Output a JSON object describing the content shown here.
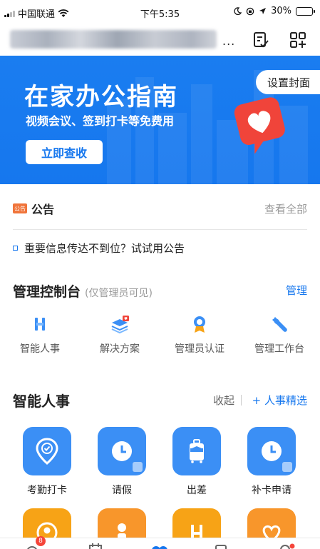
{
  "status_bar": {
    "carrier": "中国联通",
    "time": "下午5:35",
    "battery": "30%",
    "battery_level": 0.3
  },
  "title_bar": {
    "more": "..."
  },
  "banner": {
    "title": "在家办公指南",
    "subtitle": "视频会议、签到打卡等免费用",
    "action": "立即查收",
    "cover_button": "设置封面",
    "background_color": "#1677ee"
  },
  "notice": {
    "badge": "公告",
    "title": "公告",
    "view_all": "查看全部",
    "item": "重要信息传达不到位？试试用公告"
  },
  "admin_console": {
    "title": "管理控制台",
    "note": "(仅管理员可见)",
    "manage": "管理",
    "items": [
      {
        "label": "智能人事",
        "icon": "smart-hr-icon"
      },
      {
        "label": "解决方案",
        "icon": "layers-icon"
      },
      {
        "label": "管理员认证",
        "icon": "badge-icon"
      },
      {
        "label": "管理工作台",
        "icon": "wrench-icon"
      }
    ]
  },
  "smart_hr": {
    "title": "智能人事",
    "collapse": "收起",
    "featured": "+ 人事精选",
    "apps": [
      {
        "label": "考勤打卡",
        "icon": "location-check-icon"
      },
      {
        "label": "请假",
        "icon": "clock-icon"
      },
      {
        "label": "出差",
        "icon": "suitcase-icon"
      },
      {
        "label": "补卡申请",
        "icon": "clock-icon"
      }
    ]
  },
  "tab_bar": {
    "message_badge": "8"
  },
  "colors": {
    "accent": "#1677ee",
    "notice_badge": "#f0743a",
    "app_blue": "#3b8ff5",
    "app_orange": "#f7a316",
    "badge_red": "#f5453a"
  }
}
